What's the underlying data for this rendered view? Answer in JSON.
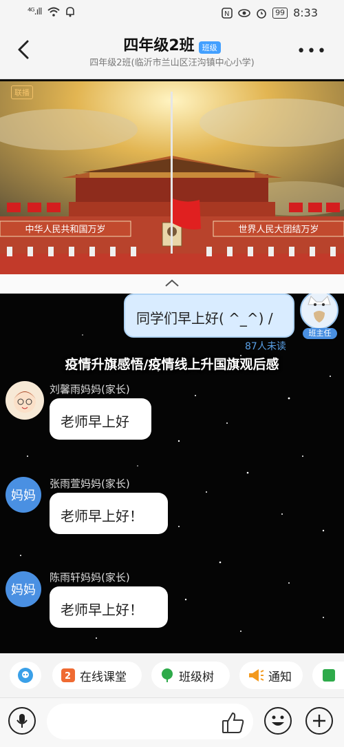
{
  "status_bar": {
    "signal": "⁴ᴳ.ıll",
    "battery": "99",
    "time": "8:33"
  },
  "header": {
    "title": "四年级2班",
    "tag": "班级",
    "subtitle": "四年级2班(临沂市兰山区汪沟镇中心小学)"
  },
  "video": {
    "live_badge": "联播",
    "left_banner": "中华人民共和国万岁",
    "right_banner": "世界人民大团结万岁"
  },
  "chat": {
    "sent": {
      "text": "同学们早上好( ^_^) /",
      "read_status": "87人未读",
      "avatar_label": "班主任"
    },
    "overlay_title": "疫情升旗感悟/疫情线上升国旗观后感",
    "messages": [
      {
        "sender": "刘馨雨妈妈(家长)",
        "text": "老师早上好",
        "avatar": "cartoon"
      },
      {
        "sender": "张雨萱妈妈(家长)",
        "text": "老师早上好！",
        "avatar": "妈妈"
      },
      {
        "sender": "陈雨轩妈妈(家长)",
        "text": "老师早上好！",
        "avatar": "妈妈"
      }
    ]
  },
  "toolbar": {
    "items": [
      {
        "label": "在线课堂",
        "icon": "online-class-icon"
      },
      {
        "label": "班级树",
        "icon": "class-tree-icon"
      },
      {
        "label": "通知",
        "icon": "notice-icon"
      }
    ]
  },
  "colors": {
    "accent": "#43a0ff",
    "bubble_mine": "#d9ecff"
  }
}
